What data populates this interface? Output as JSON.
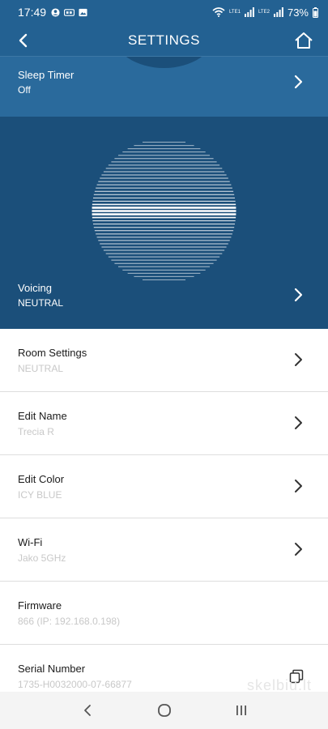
{
  "status_bar": {
    "time": "17:49",
    "battery": "73%",
    "icons": [
      "account-circle-icon",
      "vpn-icon",
      "image-icon",
      "wifi-icon",
      "volte-lte1-icon",
      "signal-bars-icon",
      "volte-lte2-icon",
      "signal-bars-icon",
      "battery-icon"
    ],
    "net_lte1": "LTE1",
    "net_lte2": "LTE2"
  },
  "header": {
    "title": "SETTINGS",
    "back_icon": "chevron-left-icon",
    "home_icon": "home-icon"
  },
  "sleep_timer": {
    "label": "Sleep Timer",
    "value": "Off"
  },
  "voicing": {
    "label": "Voicing",
    "value": "NEUTRAL"
  },
  "settings_items": [
    {
      "label": "Room Settings",
      "value": "NEUTRAL",
      "icon": "chevron-right-icon"
    },
    {
      "label": "Edit Name",
      "value": "Trecia R",
      "icon": "chevron-right-icon"
    },
    {
      "label": "Edit Color",
      "value": "ICY BLUE",
      "icon": "chevron-right-icon"
    },
    {
      "label": "Wi-Fi",
      "value": "Jako 5GHz",
      "icon": "chevron-right-icon"
    },
    {
      "label": "Firmware",
      "value": "866 (IP: 192.168.0.198)"
    },
    {
      "label": "Serial Number",
      "value": "1735-H0032000-07-66877",
      "icon": "copy-icon"
    }
  ],
  "watermark": "skelbiu.lt",
  "colors": {
    "header_blue": "#236192",
    "sleep_blue": "#2a6a9c",
    "voicing_blue": "#1b4f7a",
    "secondary_text": "#c8c8c8"
  },
  "nav_bar": [
    "back-nav-icon",
    "home-nav-icon",
    "recents-nav-icon"
  ]
}
